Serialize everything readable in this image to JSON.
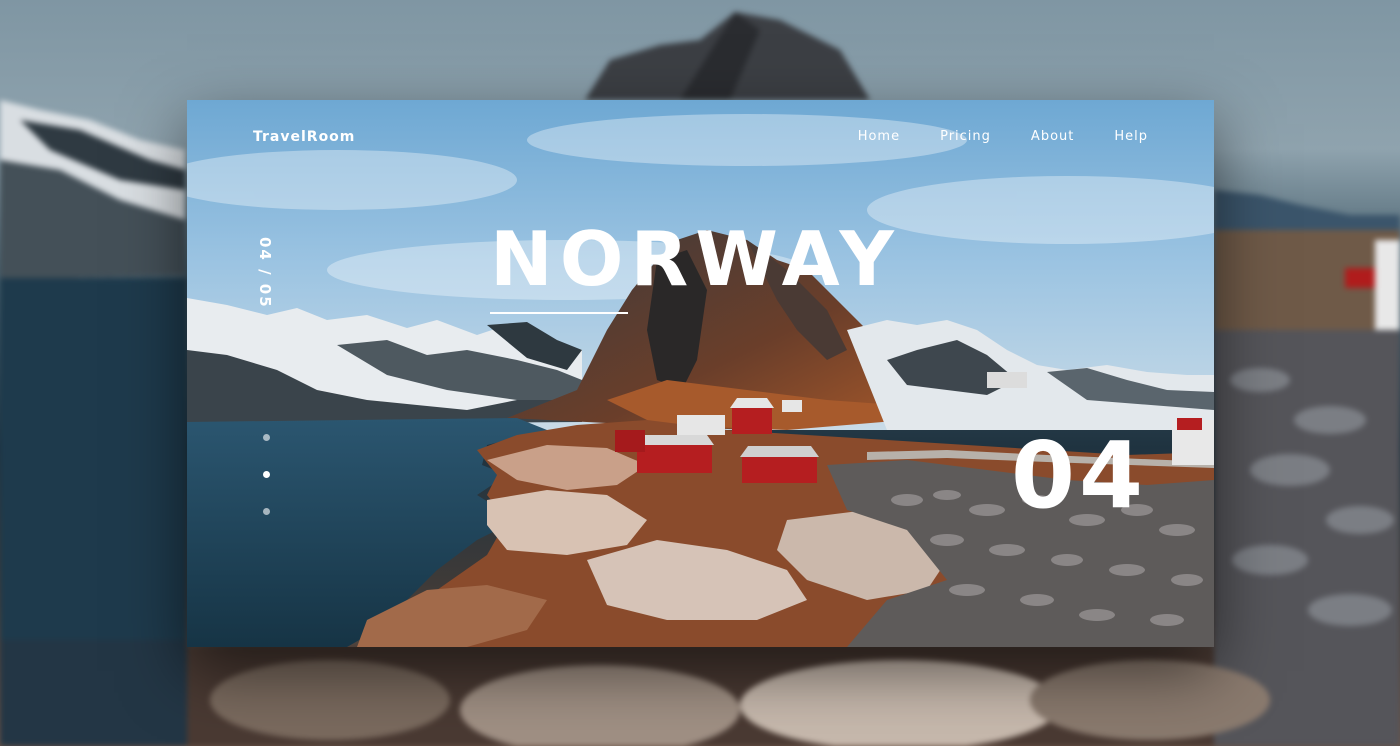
{
  "brand": {
    "name": "TravelRoom"
  },
  "nav": {
    "items": [
      {
        "label": "Home"
      },
      {
        "label": "Pricing"
      },
      {
        "label": "About"
      },
      {
        "label": "Help"
      }
    ]
  },
  "hero": {
    "title": "NORWAY",
    "slide_counter": "04 / 05",
    "slide_number": "04"
  },
  "slider": {
    "dot_count": 3,
    "active_index": 1
  },
  "colors": {
    "text": "#ffffff",
    "sky": "#7fb3da",
    "water": "#20485c",
    "rock": "#8a4a2a",
    "cabin": "#b51e20"
  }
}
